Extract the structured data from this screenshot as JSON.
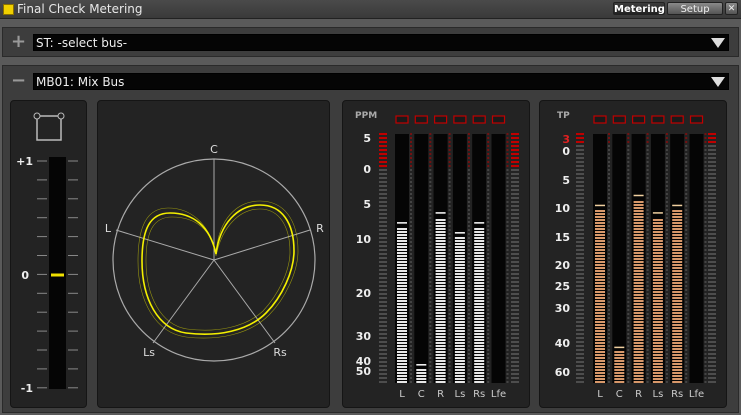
{
  "window": {
    "title": "Final Check Metering"
  },
  "toolbar": {
    "metering_label": "Metering",
    "setup_label": "Setup"
  },
  "bus_st": {
    "toggle": "+",
    "value": "ST: -select bus-"
  },
  "bus_mb": {
    "toggle": "−",
    "value": "MB01: Mix Bus"
  },
  "balance": {
    "scale": [
      "+1",
      "0",
      "-1"
    ],
    "level": 0.5
  },
  "surround": {
    "labels": {
      "c": "C",
      "l": "L",
      "r": "R",
      "ls": "Ls",
      "rs": "Rs"
    }
  },
  "ppm": {
    "header": "PPM",
    "scale": [
      "5",
      "0",
      "5",
      "10",
      "20",
      "30",
      "40",
      "50"
    ],
    "channels": [
      "L",
      "C",
      "R",
      "Ls",
      "Rs",
      "Lfe"
    ],
    "levels": [
      0.63,
      0.06,
      0.67,
      0.59,
      0.63,
      0.0
    ]
  },
  "tp": {
    "header": "TP",
    "over_label": "3",
    "scale": [
      "0",
      "5",
      "10",
      "15",
      "20",
      "25",
      "30",
      "40",
      "60"
    ],
    "channels": [
      "L",
      "C",
      "R",
      "Ls",
      "Rs",
      "Lfe"
    ],
    "levels": [
      0.7,
      0.13,
      0.74,
      0.67,
      0.7,
      0.0
    ]
  },
  "colors": {
    "ppm_bar": "#e8e8e8",
    "tp_bar": "#d8986a",
    "over": "#c00000",
    "scope": "#f4f000"
  }
}
